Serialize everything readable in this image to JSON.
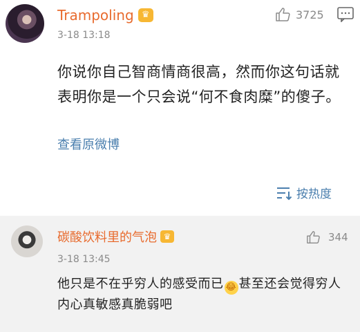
{
  "main_comment": {
    "username": "Trampoling",
    "like_count": "3725",
    "timestamp": "3-18 13:18",
    "text": "你说你自己智商情商很高，然而你这句话就表明你是一个只会说“何不食肉糜”的傻子。",
    "view_original_label": "查看原微博",
    "icons": {
      "avatar": "avatar-image",
      "badge": "vip-crown-icon",
      "like": "thumbs-up-icon",
      "reply": "comment-icon"
    }
  },
  "sort": {
    "label": "按热度",
    "icon": "sort-hot-icon"
  },
  "reply": {
    "username": "碳酸饮料里的气泡",
    "like_count": "344",
    "timestamp": "3-18 13:45",
    "text_part1": "他只是不在乎穷人的感受而已",
    "text_part2": "甚至还会觉得穷人内心真敏感真脆弱吧",
    "icons": {
      "avatar": "avatar-image",
      "badge": "vip-crown-icon",
      "like": "thumbs-up-icon",
      "emoji": "laughing-tears-emoji"
    }
  },
  "colors": {
    "username": "#e86b2e",
    "link": "#4b7fae",
    "badge": "#f7b733",
    "meta_text": "#8a8a8a",
    "body_text": "#222222",
    "reply_bg": "#f2f2f2"
  }
}
